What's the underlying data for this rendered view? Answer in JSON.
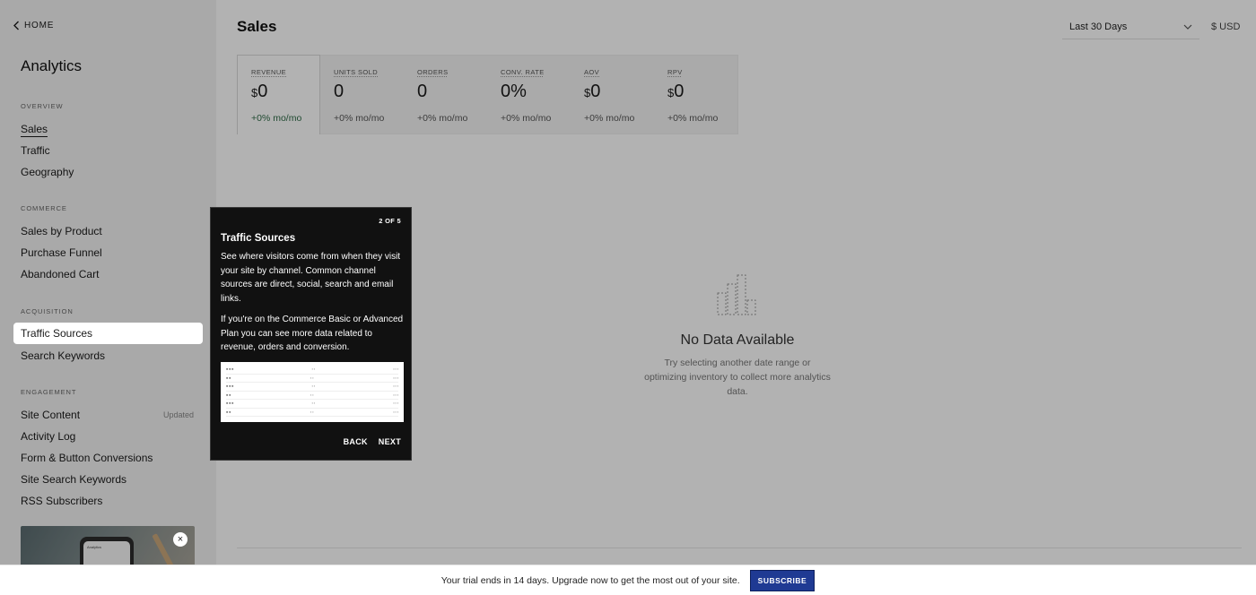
{
  "sidebar": {
    "home_label": "HOME",
    "title": "Analytics",
    "sections": {
      "overview": "OVERVIEW",
      "commerce": "COMMERCE",
      "acquisition": "ACQUISITION",
      "engagement": "ENGAGEMENT"
    },
    "items": {
      "sales": "Sales",
      "traffic": "Traffic",
      "geography": "Geography",
      "sales_by_product": "Sales by Product",
      "purchase_funnel": "Purchase Funnel",
      "abandoned_cart": "Abandoned Cart",
      "traffic_sources": "Traffic Sources",
      "search_keywords": "Search Keywords",
      "site_content": "Site Content",
      "activity_log": "Activity Log",
      "form_button_conversions": "Form & Button Conversions",
      "site_search_keywords": "Site Search Keywords",
      "rss_subscribers": "RSS Subscribers"
    },
    "updated_tag": "Updated",
    "promo_close": "×",
    "promo_phone_text": "Analytics"
  },
  "header": {
    "title": "Sales",
    "date_range": "Last 30 Days",
    "currency": "$ USD"
  },
  "metrics": [
    {
      "label": "REVENUE",
      "currency": "$",
      "value": "0",
      "change": "+0% mo/mo"
    },
    {
      "label": "UNITS SOLD",
      "currency": "",
      "value": "0",
      "change": "+0% mo/mo"
    },
    {
      "label": "ORDERS",
      "currency": "",
      "value": "0",
      "change": "+0% mo/mo"
    },
    {
      "label": "CONV. RATE",
      "currency": "",
      "value": "0%",
      "change": "+0% mo/mo"
    },
    {
      "label": "AOV",
      "currency": "$",
      "value": "0",
      "change": "+0% mo/mo"
    },
    {
      "label": "RPV",
      "currency": "$",
      "value": "0",
      "change": "+0% mo/mo"
    }
  ],
  "empty_state": {
    "title": "No Data Available",
    "text": "Try selecting another date range or optimizing inventory to collect more analytics data."
  },
  "tour": {
    "step": "2 OF 5",
    "title": "Traffic Sources",
    "paragraph1": "See where visitors come from when they visit your site by channel. Common channel sources are direct, social, search and email links.",
    "paragraph2": "If you're on the Commerce Basic or Advanced Plan you can see more data related to revenue, orders and conversion.",
    "back_label": "BACK",
    "next_label": "NEXT"
  },
  "trial": {
    "text": "Your trial ends in 14 days. Upgrade now to get the most out of your site.",
    "subscribe_label": "SUBSCRIBE"
  },
  "colors": {
    "accent_green": "#2e6b47",
    "subscribe_blue": "#1f3a93"
  },
  "icons": {
    "home": "chevron-left-icon",
    "date_range": "chevron-down-icon",
    "empty_state": "bar-chart-icon",
    "promo_close": "close-icon"
  }
}
